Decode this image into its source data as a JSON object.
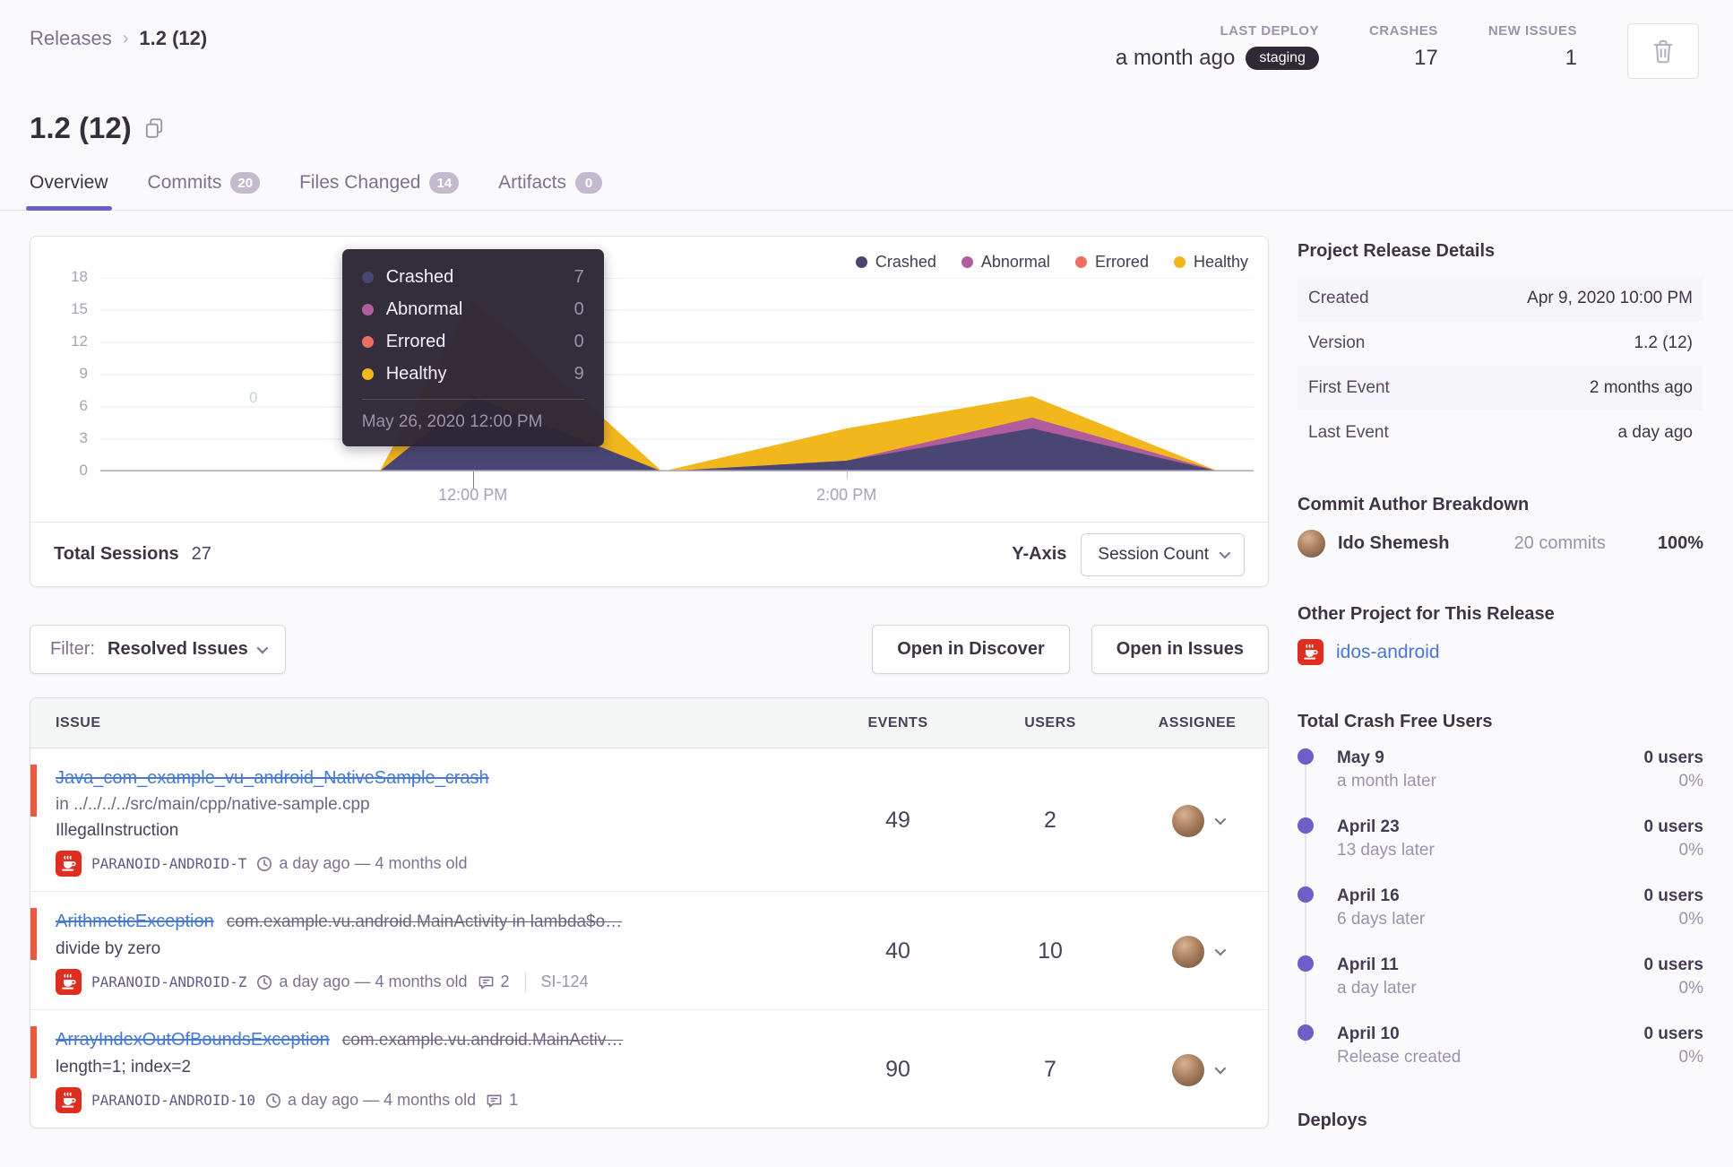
{
  "breadcrumb": {
    "root": "Releases",
    "current": "1.2 (12)"
  },
  "header_stats": {
    "last_deploy": {
      "label": "LAST DEPLOY",
      "value": "a month ago",
      "env": "staging"
    },
    "crashes": {
      "label": "CRASHES",
      "value": "17"
    },
    "new_issues": {
      "label": "NEW ISSUES",
      "value": "1"
    }
  },
  "page_title": "1.2 (12)",
  "tabs": [
    {
      "label": "Overview",
      "badge": "",
      "active": true
    },
    {
      "label": "Commits",
      "badge": "20",
      "active": false
    },
    {
      "label": "Files Changed",
      "badge": "14",
      "active": false
    },
    {
      "label": "Artifacts",
      "badge": "0",
      "active": false
    }
  ],
  "chart": {
    "legend": [
      {
        "label": "Crashed"
      },
      {
        "label": "Abnormal"
      },
      {
        "label": "Errored"
      },
      {
        "label": "Healthy"
      }
    ],
    "tooltip": {
      "rows": [
        {
          "label": "Crashed",
          "value": "7"
        },
        {
          "label": "Abnormal",
          "value": "0"
        },
        {
          "label": "Errored",
          "value": "0"
        },
        {
          "label": "Healthy",
          "value": "9"
        }
      ],
      "footer": "May 26, 2020 12:00 PM"
    },
    "ghost_label": "0",
    "footer": {
      "total_label": "Total Sessions",
      "total_value": "27",
      "yaxis_label": "Y-Axis",
      "yaxis_value": "Session Count"
    }
  },
  "chart_data": {
    "type": "area",
    "stacked": true,
    "x_labels": [
      "10:00 AM",
      "11:00 AM",
      "11:30 AM",
      "12:00 PM",
      "1:00 PM",
      "2:00 PM",
      "3:00 PM",
      "4:00 PM",
      "4:10 PM"
    ],
    "x_fractions": [
      0,
      0.162,
      0.242,
      0.323,
      0.487,
      0.647,
      0.808,
      0.97,
      1
    ],
    "series": [
      {
        "name": "Crashed",
        "color": "#4a4673",
        "values": [
          0,
          0,
          0,
          7,
          0,
          1,
          4,
          0,
          0
        ]
      },
      {
        "name": "Abnormal",
        "color": "#b05c9d",
        "values": [
          0,
          0,
          0,
          0,
          0,
          0,
          1,
          0,
          0
        ]
      },
      {
        "name": "Errored",
        "color": "#ec7061",
        "values": [
          0,
          0,
          0,
          0,
          0,
          0,
          0,
          0,
          0
        ]
      },
      {
        "name": "Healthy",
        "color": "#f1b71c",
        "values": [
          0,
          0,
          0,
          9,
          0,
          3,
          2,
          0,
          0
        ]
      }
    ],
    "ylim": [
      0,
      18
    ],
    "y_ticks": [
      0,
      3,
      6,
      9,
      12,
      15,
      18
    ],
    "x_axis_ticks": [
      {
        "label": "12:00 PM",
        "f": 0.323
      },
      {
        "label": "2:00 PM",
        "f": 0.647
      }
    ],
    "grid": "horizontal",
    "legend_position": "top-right",
    "total_sessions": 27,
    "hover_tooltip": {
      "date": "May 26, 2020 12:00 PM",
      "anchor_f": 0.323,
      "values": {
        "Crashed": 7,
        "Abnormal": 0,
        "Errored": 0,
        "Healthy": 9
      }
    }
  },
  "toolbar": {
    "filter_label": "Filter:",
    "filter_value": "Resolved Issues",
    "discover_button": "Open in Discover",
    "issues_button": "Open in Issues"
  },
  "issues_table": {
    "columns": {
      "issue": "ISSUE",
      "events": "EVENTS",
      "users": "USERS",
      "assignee": "ASSIGNEE"
    },
    "rows": [
      {
        "title": "Java_com_example_vu_android_NativeSample_crash",
        "culprit": "",
        "culprit_line": "in ../../../../src/main/cpp/native-sample.cpp",
        "message": "IllegalInstruction",
        "project": "PARANOID-ANDROID-T",
        "age": "a day ago — 4 months old",
        "comments": "",
        "annotation": "",
        "events": "49",
        "users": "2"
      },
      {
        "title": "ArithmeticException",
        "culprit": "com.example.vu.android.MainActivity in lambda$o…",
        "culprit_line": "",
        "message": "divide by zero",
        "project": "PARANOID-ANDROID-Z",
        "age": "a day ago — 4 months old",
        "comments": "2",
        "annotation": "SI-124",
        "events": "40",
        "users": "10"
      },
      {
        "title": "ArrayIndexOutOfBoundsException",
        "culprit": "com.example.vu.android.MainActiv…",
        "culprit_line": "",
        "message": "length=1; index=2",
        "project": "PARANOID-ANDROID-10",
        "age": "a day ago — 4 months old",
        "comments": "1",
        "annotation": "",
        "events": "90",
        "users": "7"
      }
    ]
  },
  "sidebar": {
    "details": {
      "heading": "Project Release Details",
      "rows": [
        {
          "key": "Created",
          "value": "Apr 9, 2020 10:00 PM"
        },
        {
          "key": "Version",
          "value": "1.2 (12)"
        },
        {
          "key": "First Event",
          "value": "2 months ago"
        },
        {
          "key": "Last Event",
          "value": "a day ago"
        }
      ]
    },
    "authors": {
      "heading": "Commit Author Breakdown",
      "name": "Ido Shemesh",
      "commits": "20 commits",
      "percent": "100%"
    },
    "other_project": {
      "heading": "Other Project for This Release",
      "link": "idos-android"
    },
    "crash_free": {
      "heading": "Total Crash Free Users",
      "items": [
        {
          "date": "May 9",
          "desc": "a month later",
          "users": "0 users",
          "pct": "0%"
        },
        {
          "date": "April 23",
          "desc": "13 days later",
          "users": "0 users",
          "pct": "0%"
        },
        {
          "date": "April 16",
          "desc": "6 days later",
          "users": "0 users",
          "pct": "0%"
        },
        {
          "date": "April 11",
          "desc": "a day later",
          "users": "0 users",
          "pct": "0%"
        },
        {
          "date": "April 10",
          "desc": "Release created",
          "users": "0 users",
          "pct": "0%"
        }
      ]
    },
    "deploys_heading": "Deploys"
  },
  "colors": {
    "accent_purple": "#6c5fc7",
    "link_blue": "#4678d4",
    "error_level_red": "#ea5a43",
    "project_icon_red": "#dd2e1f",
    "staging_pill_bg": "#2f2936"
  }
}
